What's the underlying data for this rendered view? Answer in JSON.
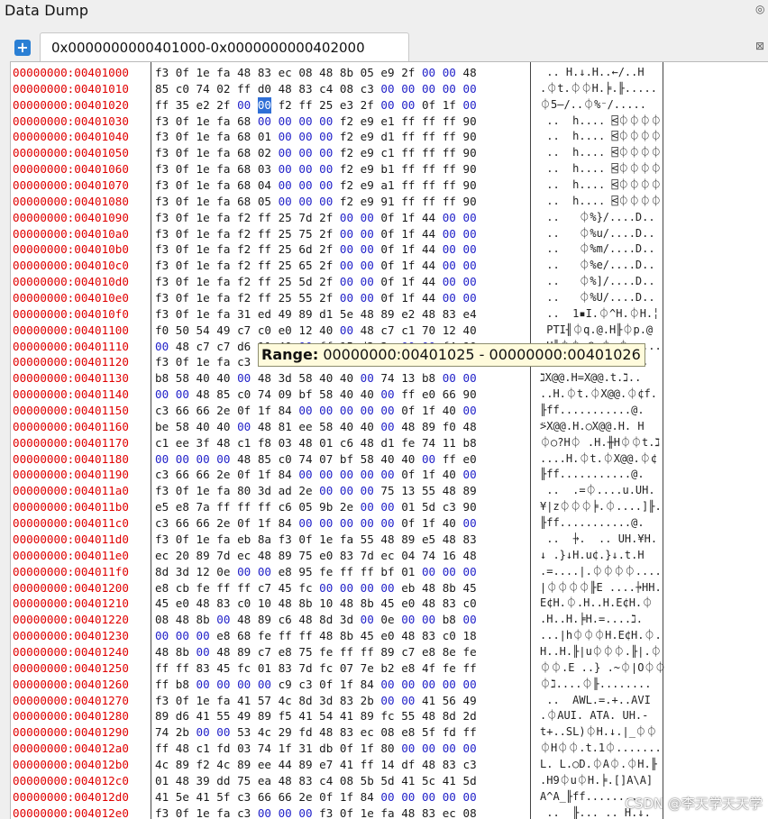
{
  "title": "Data Dump",
  "tab": {
    "label": "0x0000000000401000-0x0000000000402000"
  },
  "tooltip": {
    "label": "Range:",
    "value": "00000000:00401025 - 00000000:00401026"
  },
  "watermark": "CSDN @李天学天天学",
  "selection": {
    "row": 2,
    "byte": 5
  },
  "colors": {
    "address": "#e00000",
    "zero_byte": "#1f1fc8",
    "selection": "#2f6fd6",
    "tooltip_bg": "#fffbdc"
  },
  "rows": [
    {
      "addr": "00000000:00401000",
      "hex": "f3 0f 1e fa 48 83 ec 08 48 8b 05 e9 2f 00 00 48",
      "ascii": " .. H.↓.H..←/..H"
    },
    {
      "addr": "00000000:00401010",
      "hex": "85 c0 74 02 ff d0 48 83 c4 08 c3 00 00 00 00 00",
      "ascii": ".⏀t.⏀⏀H.╞.╟....."
    },
    {
      "addr": "00000000:00401020",
      "hex": "ff 35 e2 2f 00 00 f2 ff 25 e3 2f 00 00 0f 1f 00",
      "ascii": "⏀5–/..⏀%⁻/....."
    },
    {
      "addr": "00000000:00401030",
      "hex": "f3 0f 1e fa 68 00 00 00 00 f2 e9 e1 ff ff ff 90",
      "ascii": " ..  h.... ⍃⏀⏀⏀⏀"
    },
    {
      "addr": "00000000:00401040",
      "hex": "f3 0f 1e fa 68 01 00 00 00 f2 e9 d1 ff ff ff 90",
      "ascii": " ..  h.... ⍃⏀⏀⏀⏀"
    },
    {
      "addr": "00000000:00401050",
      "hex": "f3 0f 1e fa 68 02 00 00 00 f2 e9 c1 ff ff ff 90",
      "ascii": " ..  h.... ⍃⏀⏀⏀⏀"
    },
    {
      "addr": "00000000:00401060",
      "hex": "f3 0f 1e fa 68 03 00 00 00 f2 e9 b1 ff ff ff 90",
      "ascii": " ..  h.... ⍃⏀⏀⏀⏀"
    },
    {
      "addr": "00000000:00401070",
      "hex": "f3 0f 1e fa 68 04 00 00 00 f2 e9 a1 ff ff ff 90",
      "ascii": " ..  h.... ⍃⏀⏀⏀⏀"
    },
    {
      "addr": "00000000:00401080",
      "hex": "f3 0f 1e fa 68 05 00 00 00 f2 e9 91 ff ff ff 90",
      "ascii": " ..  h.... ⍃⏀⏀⏀⏀"
    },
    {
      "addr": "00000000:00401090",
      "hex": "f3 0f 1e fa f2 ff 25 7d 2f 00 00 0f 1f 44 00 00",
      "ascii": " ..   ⏀%}/....D.."
    },
    {
      "addr": "00000000:004010a0",
      "hex": "f3 0f 1e fa f2 ff 25 75 2f 00 00 0f 1f 44 00 00",
      "ascii": " ..   ⏀%u/....D.."
    },
    {
      "addr": "00000000:004010b0",
      "hex": "f3 0f 1e fa f2 ff 25 6d 2f 00 00 0f 1f 44 00 00",
      "ascii": " ..   ⏀%m/....D.."
    },
    {
      "addr": "00000000:004010c0",
      "hex": "f3 0f 1e fa f2 ff 25 65 2f 00 00 0f 1f 44 00 00",
      "ascii": " ..   ⏀%e/....D.."
    },
    {
      "addr": "00000000:004010d0",
      "hex": "f3 0f 1e fa f2 ff 25 5d 2f 00 00 0f 1f 44 00 00",
      "ascii": " ..   ⏀%]/....D.."
    },
    {
      "addr": "00000000:004010e0",
      "hex": "f3 0f 1e fa f2 ff 25 55 2f 00 00 0f 1f 44 00 00",
      "ascii": " ..   ⏀%U/....D.."
    },
    {
      "addr": "00000000:004010f0",
      "hex": "f3 0f 1e fa 31 ed 49 89 d1 5e 48 89 e2 48 83 e4",
      "ascii": " ..  1▪I.⏀^H.⏀H.╎"
    },
    {
      "addr": "00000000:00401100",
      "hex": "f0 50 54 49 c7 c0 e0 12 40 00 48 c7 c1 70 12 40",
      "ascii": " PTI╢⏀q.@.H╟⏀p.@"
    },
    {
      "addr": "00000000:00401110",
      "hex": "00 48 c7 c7 d6 11 40 00 ff 15 d2 2e 00 00 f4 90",
      "ascii": ".H╟⏀⏀.@.⏀.⏀....."
    },
    {
      "addr": "00000000:00401120",
      "hex": "f3 0f 1e fa c3 66 2e 0f 1f 84 00 00 00 00 00 90",
      "ascii": " .. ⏀f.........."
    },
    {
      "addr": "00000000:00401130",
      "hex": "b8 58 40 40 00 48 3d 58 40 40 00 74 13 b8 00 00",
      "ascii": "ℷX@@.H=X@@.t.ℷ.."
    },
    {
      "addr": "00000000:00401140",
      "hex": "00 00 48 85 c0 74 09 bf 58 40 40 00 ff e0 66 90",
      "ascii": "..H.⏀t.⏀X@@.⏀¢f."
    },
    {
      "addr": "00000000:00401150",
      "hex": "c3 66 66 2e 0f 1f 84 00 00 00 00 00 0f 1f 40 00",
      "ascii": "╟ff...........@."
    },
    {
      "addr": "00000000:00401160",
      "hex": "be 58 40 40 00 48 81 ee 58 40 40 00 48 89 f0 48",
      "ascii": "⍩X@@.H.○X@@.H. H"
    },
    {
      "addr": "00000000:00401170",
      "hex": "c1 ee 3f 48 c1 f8 03 48 01 c6 48 d1 fe 74 11 b8",
      "ascii": "⏀○?H⏀ .H.╫H⏀⏀t.ℷ"
    },
    {
      "addr": "00000000:00401180",
      "hex": "00 00 00 00 48 85 c0 74 07 bf 58 40 40 00 ff e0",
      "ascii": "....H.⏀t.⏀X@@.⏀¢"
    },
    {
      "addr": "00000000:00401190",
      "hex": "c3 66 66 2e 0f 1f 84 00 00 00 00 00 0f 1f 40 00",
      "ascii": "╟ff...........@."
    },
    {
      "addr": "00000000:004011a0",
      "hex": "f3 0f 1e fa 80 3d ad 2e 00 00 00 75 13 55 48 89",
      "ascii": " ..  .=⏀....u.UH."
    },
    {
      "addr": "00000000:004011b0",
      "hex": "e5 e8 7a ff ff ff c6 05 9b 2e 00 00 01 5d c3 90",
      "ascii": "¥∣z⏀⏀⏀╞.⏀....]╟."
    },
    {
      "addr": "00000000:004011c0",
      "hex": "c3 66 66 2e 0f 1f 84 00 00 00 00 00 0f 1f 40 00",
      "ascii": "╟ff...........@."
    },
    {
      "addr": "00000000:004011d0",
      "hex": "f3 0f 1e fa eb 8a f3 0f 1e fa 55 48 89 e5 48 83",
      "ascii": " ..  ⍆.  .. UH.¥H."
    },
    {
      "addr": "00000000:004011e0",
      "hex": "ec 20 89 7d ec 48 89 75 e0 83 7d ec 04 74 16 48",
      "ascii": "↓ .}↓H.u¢.}↓.t.H"
    },
    {
      "addr": "00000000:004011f0",
      "hex": "8d 3d 12 0e 00 00 e8 95 fe ff ff bf 01 00 00 00",
      "ascii": ".=....∣.⏀⏀⏀⏀...."
    },
    {
      "addr": "00000000:00401200",
      "hex": "e8 cb fe ff ff c7 45 fc 00 00 00 00 eb 48 8b 45",
      "ascii": "∣⏀⏀⏀⏀╟E ....⍆HH."
    },
    {
      "addr": "00000000:00401210",
      "hex": "45 e0 48 83 c0 10 48 8b 10 48 8b 45 e0 48 83 c0",
      "ascii": "E¢H.⏀.H..H.E¢H.⏀"
    },
    {
      "addr": "00000000:00401220",
      "hex": "08 48 8b 00 48 89 c6 48 8d 3d 00 0e 00 00 b8 00",
      "ascii": ".H..H.╞H.=....ℷ."
    },
    {
      "addr": "00000000:00401230",
      "hex": "00 00 00 e8 68 fe ff ff 48 8b 45 e0 48 83 c0 18",
      "ascii": "...∣h⏀⏀⏀H.E¢H.⏀."
    },
    {
      "addr": "00000000:00401240",
      "hex": "48 8b 00 48 89 c7 e8 75 fe ff ff 89 c7 e8 8e fe",
      "ascii": "H..H.╟∣u⏀⏀⏀.╟∣.⏀"
    },
    {
      "addr": "00000000:00401250",
      "hex": "ff ff 83 45 fc 01 83 7d fc 07 7e b2 e8 4f fe ff",
      "ascii": "⏀⏀.E ..} .~⏀∣O⏀⏀"
    },
    {
      "addr": "00000000:00401260",
      "hex": "ff b8 00 00 00 00 c9 c3 0f 1f 84 00 00 00 00 00",
      "ascii": "⏀ℷ....⏀╟........"
    },
    {
      "addr": "00000000:00401270",
      "hex": "f3 0f 1e fa 41 57 4c 8d 3d 83 2b 00 00 41 56 49",
      "ascii": " ..  AWL.=.+..AVI"
    },
    {
      "addr": "00000000:00401280",
      "hex": "89 d6 41 55 49 89 f5 41 54 41 89 fc 55 48 8d 2d",
      "ascii": ".⏀AUI. ATA. UH.-"
    },
    {
      "addr": "00000000:00401290",
      "hex": "74 2b 00 00 53 4c 29 fd 48 83 ec 08 e8 5f fd ff",
      "ascii": "t+..SL)⏀H.↓.∣_⏀⏀"
    },
    {
      "addr": "00000000:004012a0",
      "hex": "ff 48 c1 fd 03 74 1f 31 db 0f 1f 80 00 00 00 00",
      "ascii": "⏀H⏀⏀.t.1⏀......."
    },
    {
      "addr": "00000000:004012b0",
      "hex": "4c 89 f2 4c 89 ee 44 89 e7 41 ff 14 df 48 83 c3",
      "ascii": "L. L.○D.⏀A⏀.⏀H.╟"
    },
    {
      "addr": "00000000:004012c0",
      "hex": "01 48 39 dd 75 ea 48 83 c4 08 5b 5d 41 5c 41 5d",
      "ascii": ".H9⏀u⏀H.╞.[]A\\A]"
    },
    {
      "addr": "00000000:004012d0",
      "hex": "41 5e 41 5f c3 66 66 2e 0f 1f 84 00 00 00 00 00",
      "ascii": "A^A_╟ff.........."
    },
    {
      "addr": "00000000:004012e0",
      "hex": "f3 0f 1e fa c3 00 00 00 f3 0f 1e fa 48 83 ec 08",
      "ascii": " ..  ╟... .. H.↓."
    }
  ]
}
